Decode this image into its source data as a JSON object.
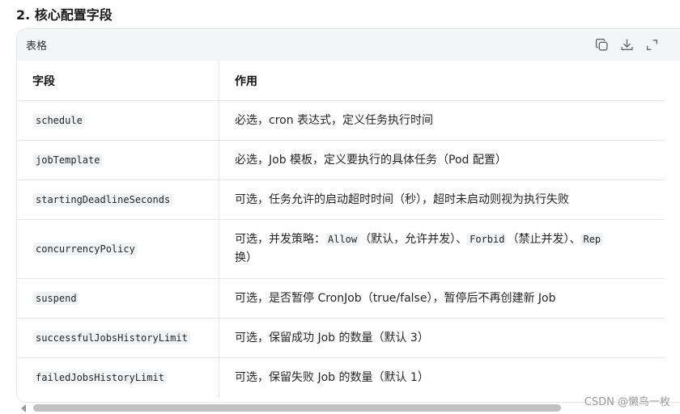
{
  "section": {
    "title": "2. 核心配置字段"
  },
  "card": {
    "title": "表格",
    "actions": [
      "copy-icon",
      "download-icon",
      "expand-icon"
    ]
  },
  "table": {
    "headers": [
      "字段",
      "作用"
    ],
    "rows": [
      {
        "field": "schedule",
        "desc": "必选，cron 表达式，定义任务执行时间"
      },
      {
        "field": "jobTemplate",
        "desc": "必选，Job 模板，定义要执行的具体任务（Pod 配置）"
      },
      {
        "field": "startingDeadlineSeconds",
        "desc": "可选，任务允许的启动超时时间（秒），超时未启动则视为执行失败"
      },
      {
        "field": "concurrencyPolicy",
        "desc_parts": {
          "p1": "可选，并发策略：",
          "c1": "Allow",
          "p2": "（默认，允许并发）、",
          "c2": "Forbid",
          "p3": "（禁止并发）、",
          "c3": "Rep",
          "line2": "换）"
        }
      },
      {
        "field": "suspend",
        "desc": "可选，是否暂停 CronJob（true/false），暂停后不再创建新 Job"
      },
      {
        "field": "successfulJobsHistoryLimit",
        "desc": "可选，保留成功 Job 的数量（默认 3）"
      },
      {
        "field": "failedJobsHistoryLimit",
        "desc": "可选，保留失败 Job 的数量（默认 1）"
      }
    ]
  },
  "watermark": "CSDN @懒鸟一枚"
}
